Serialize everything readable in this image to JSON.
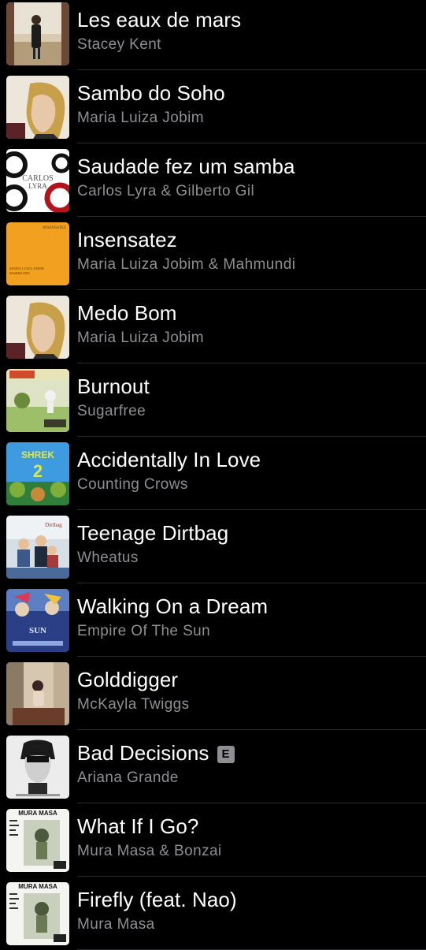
{
  "songs": [
    {
      "title": "Les eaux de mars",
      "artist": "Stacey Kent",
      "explicit": false,
      "artwork_icon": "album-cover-les-eaux-de-mars"
    },
    {
      "title": "Sambo do Soho",
      "artist": "Maria Luiza Jobim",
      "explicit": false,
      "artwork_icon": "album-cover-maria-luiza-jobim"
    },
    {
      "title": "Saudade fez um samba",
      "artist": "Carlos Lyra & Gilberto Gil",
      "explicit": false,
      "artwork_icon": "album-cover-carlos-lyra"
    },
    {
      "title": "Insensatez",
      "artist": "Maria Luiza Jobim & Mahmundi",
      "explicit": false,
      "artwork_icon": "album-cover-insensatez"
    },
    {
      "title": "Medo Bom",
      "artist": "Maria Luiza Jobim",
      "explicit": false,
      "artwork_icon": "album-cover-maria-luiza-jobim"
    },
    {
      "title": "Burnout",
      "artist": "Sugarfree",
      "explicit": false,
      "artwork_icon": "album-cover-sugarfree"
    },
    {
      "title": "Accidentally In Love",
      "artist": "Counting Crows",
      "explicit": false,
      "artwork_icon": "album-cover-shrek-2"
    },
    {
      "title": "Teenage Dirtbag",
      "artist": "Wheatus",
      "explicit": false,
      "artwork_icon": "album-cover-wheatus"
    },
    {
      "title": "Walking On a Dream",
      "artist": "Empire Of The Sun",
      "explicit": false,
      "artwork_icon": "album-cover-empire-of-the-sun"
    },
    {
      "title": "Golddigger",
      "artist": "McKayla Twiggs",
      "explicit": false,
      "artwork_icon": "album-cover-golddigger"
    },
    {
      "title": "Bad Decisions",
      "artist": "Ariana Grande",
      "explicit": true,
      "artwork_icon": "album-cover-dangerous-woman"
    },
    {
      "title": "What If I Go?",
      "artist": "Mura Masa & Bonzai",
      "explicit": false,
      "artwork_icon": "album-cover-mura-masa"
    },
    {
      "title": "Firefly (feat. Nao)",
      "artist": "Mura Masa",
      "explicit": false,
      "artwork_icon": "album-cover-mura-masa"
    }
  ],
  "explicit_badge_label": "E",
  "colors": {
    "background": "#000000",
    "title_text": "#ffffff",
    "artist_text": "#8e8e93",
    "divider": "#2a2a2c",
    "explicit_badge": "#8e8e93"
  }
}
